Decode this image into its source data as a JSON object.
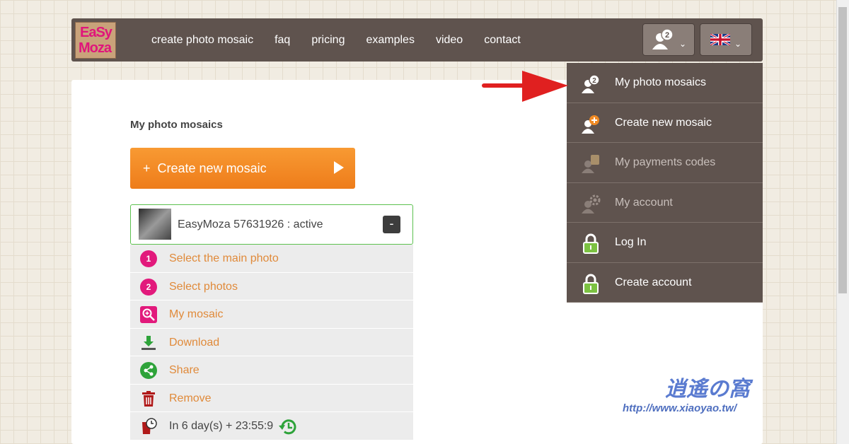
{
  "logo": {
    "line1": "EaSy",
    "line2": "Moza"
  },
  "nav": {
    "links": [
      "create photo mosaic",
      "faq",
      "pricing",
      "examples",
      "video",
      "contact"
    ],
    "user_badge_count": "2"
  },
  "main": {
    "section_title": "My photo mosaics",
    "create_button": {
      "plus": "+",
      "label": "Create new mosaic"
    },
    "mosaic": {
      "name": "EasyMoza 57631926 : active",
      "collapse": "-"
    },
    "steps": [
      {
        "num": "1",
        "label": "Select the main photo",
        "icon": "number-1-icon"
      },
      {
        "num": "2",
        "label": "Select photos",
        "icon": "number-2-icon"
      },
      {
        "label": "My mosaic",
        "icon": "zoom-icon"
      },
      {
        "label": "Download",
        "icon": "download-icon"
      },
      {
        "label": "Share",
        "icon": "share-icon"
      },
      {
        "label": "Remove",
        "icon": "trash-icon"
      }
    ],
    "expiry": "In 6 day(s) + 23:55:9"
  },
  "dropdown": {
    "items": [
      {
        "label": "My photo mosaics",
        "icon": "user-mosaics-icon",
        "active": true
      },
      {
        "label": "Create new mosaic",
        "icon": "user-add-icon",
        "active": true
      },
      {
        "label": "My payments codes",
        "icon": "payment-icon",
        "active": false
      },
      {
        "label": "My account",
        "icon": "account-gear-icon",
        "active": false
      },
      {
        "label": "Log In",
        "icon": "lock-icon",
        "active": true
      },
      {
        "label": "Create account",
        "icon": "lock-icon",
        "active": true
      }
    ]
  },
  "colors": {
    "nav_bg": "#5f534e",
    "accent_orange": "#f08a24",
    "step_magenta": "#e21a7c",
    "green": "#5cc14f",
    "arrow_red": "#e02020"
  },
  "watermark": {
    "line1": "逍遙の窩",
    "line2": "http://www.xiaoyao.tw/"
  }
}
